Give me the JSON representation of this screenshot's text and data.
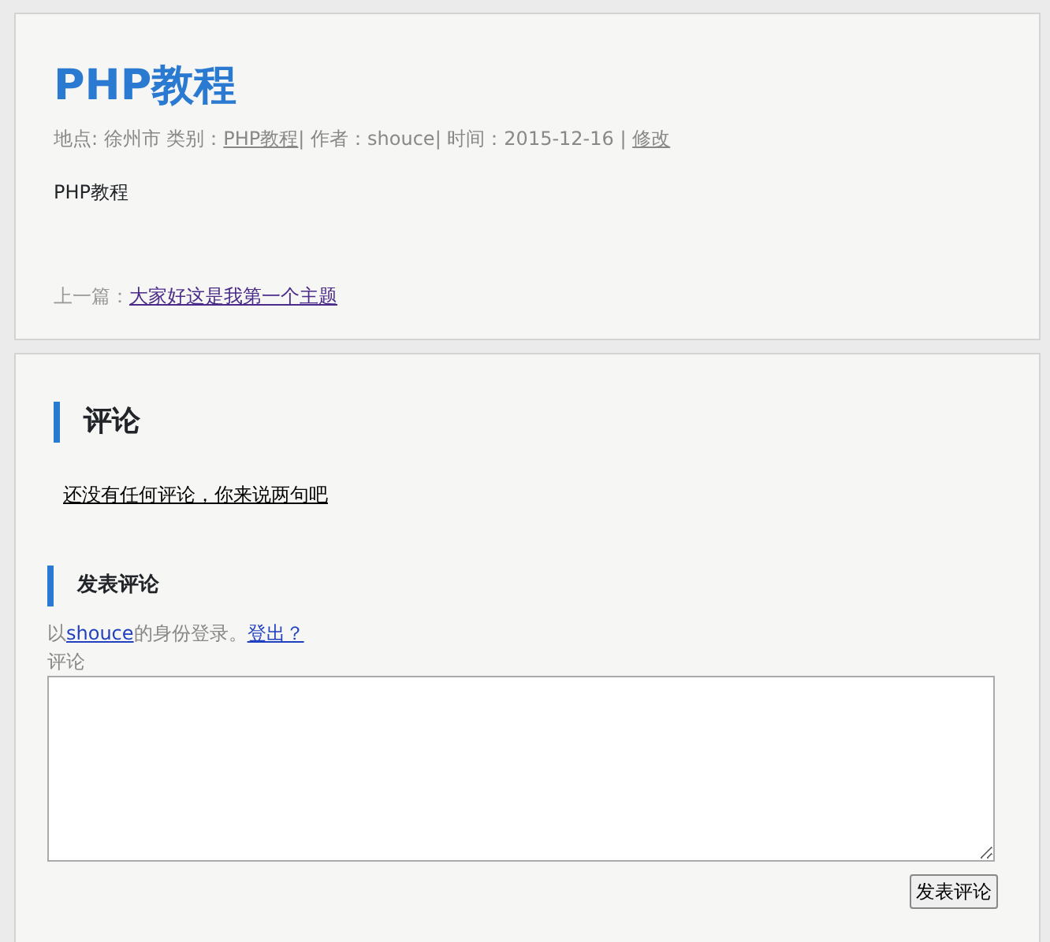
{
  "post": {
    "title": "PHP教程",
    "meta": [
      {
        "kind": "text",
        "text": "地点: 徐州市 类别："
      },
      {
        "kind": "link",
        "text": "PHP教程"
      },
      {
        "kind": "text",
        "text": "| 作者：shouce| 时间：2015-12-16 | "
      },
      {
        "kind": "link",
        "text": "修改"
      }
    ],
    "body": "PHP教程",
    "prev": [
      {
        "kind": "text",
        "text": "上一篇："
      },
      {
        "kind": "link",
        "text": "大家好这是我第一个主题"
      }
    ]
  },
  "comments": {
    "heading": "评论",
    "empty_message": "还没有任何评论，你来说两句吧",
    "form": {
      "heading": "发表评论",
      "login": [
        {
          "kind": "text",
          "text": "以"
        },
        {
          "kind": "link",
          "text": "shouce"
        },
        {
          "kind": "text",
          "text": "的身份登录。"
        },
        {
          "kind": "link",
          "text": "登出？"
        }
      ],
      "field_label": "评论",
      "submit": "发表评论"
    }
  }
}
